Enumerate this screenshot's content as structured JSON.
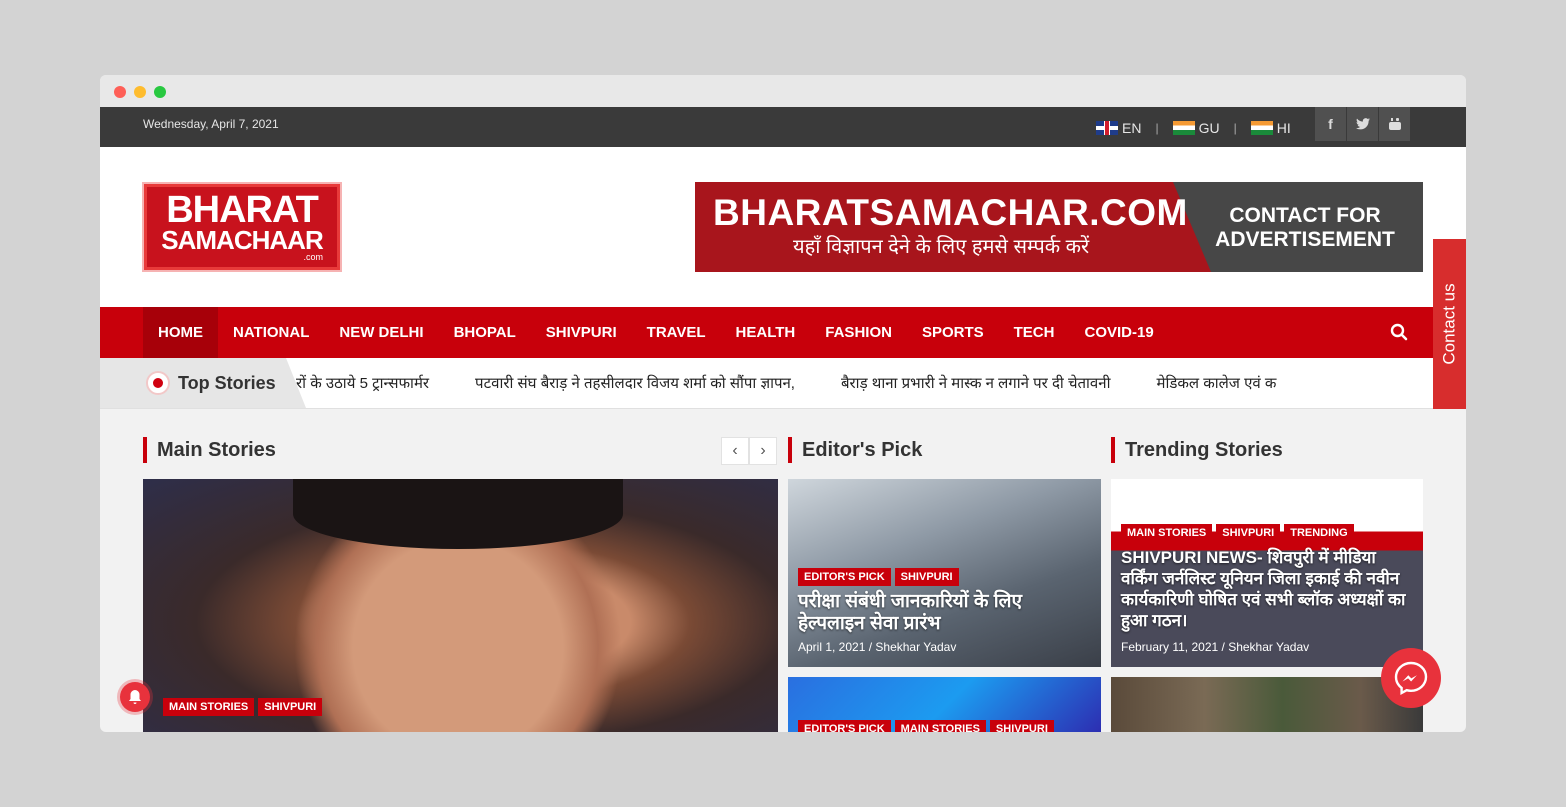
{
  "topbar": {
    "date": "Wednesday, April 7, 2021",
    "languages": [
      {
        "code": "EN",
        "flag": "uk-flag"
      },
      {
        "code": "GU",
        "flag": "india-flag"
      },
      {
        "code": "HI",
        "flag": "india-flag"
      }
    ],
    "social": [
      "facebook-icon",
      "twitter-icon",
      "youtube-icon"
    ]
  },
  "logo": {
    "line1": "BHARAT",
    "line2": "SAMACHAAR",
    "line3": ".com"
  },
  "ad": {
    "site": "BHARATSAMACHAR.COM",
    "tagline": "यहाँ विज्ञापन देने के लिए हमसे सम्पर्क करें",
    "cta_line1": "CONTACT FOR",
    "cta_line2": "ADVERTISEMENT"
  },
  "nav": {
    "items": [
      "HOME",
      "NATIONAL",
      "NEW DELHI",
      "BHOPAL",
      "SHIVPURI",
      "TRAVEL",
      "HEALTH",
      "FASHION",
      "SPORTS",
      "TECH",
      "COVID-19"
    ],
    "active": "HOME"
  },
  "contact_tab": "Contact us",
  "ticker": {
    "label": "Top Stories",
    "items": [
      "रों के उठाये 5 ट्रान्सफार्मर",
      "पटवारी संघ बैराड़ ने तहसीलदार विजय शर्मा को सौंपा ज्ञापन,",
      "बैराड़ थाना प्रभारी ने मास्क न लगाने पर दी चेतावनी",
      "मेडिकल कालेज एवं क"
    ]
  },
  "sections": {
    "main": "Main Stories",
    "editors": "Editor's Pick",
    "trending": "Trending Stories"
  },
  "main_story": {
    "cats": [
      "MAIN STORIES",
      "SHIVPURI"
    ]
  },
  "editors_pick": [
    {
      "cats": [
        "EDITOR'S PICK",
        "SHIVPURI"
      ],
      "title": "परीक्षा संबंधी जानकारियों के लिए हेल्पलाइन सेवा प्रारंभ",
      "date": "April 1, 2021",
      "author": "Shekhar Yadav"
    },
    {
      "cats": [
        "EDITOR'S PICK",
        "MAIN STORIES",
        "SHIVPURI"
      ]
    }
  ],
  "trending": [
    {
      "cats": [
        "MAIN STORIES",
        "SHIVPURI",
        "TRENDING"
      ],
      "title": "SHIVPURI NEWS- शिवपुरी में मीडिया वर्किंग जर्नलिस्ट यूनियन जिला इकाई की नवीन कार्यकारिणी घोषित एवं सभी ब्लॉक अध्यक्षों का हुआ गठन।",
      "date": "February 11, 2021",
      "author": "Shekhar Yadav"
    }
  ],
  "colors": {
    "brand_red": "#c8000b",
    "topbar": "#3a3a3a",
    "accent_red": "#e8323c"
  }
}
